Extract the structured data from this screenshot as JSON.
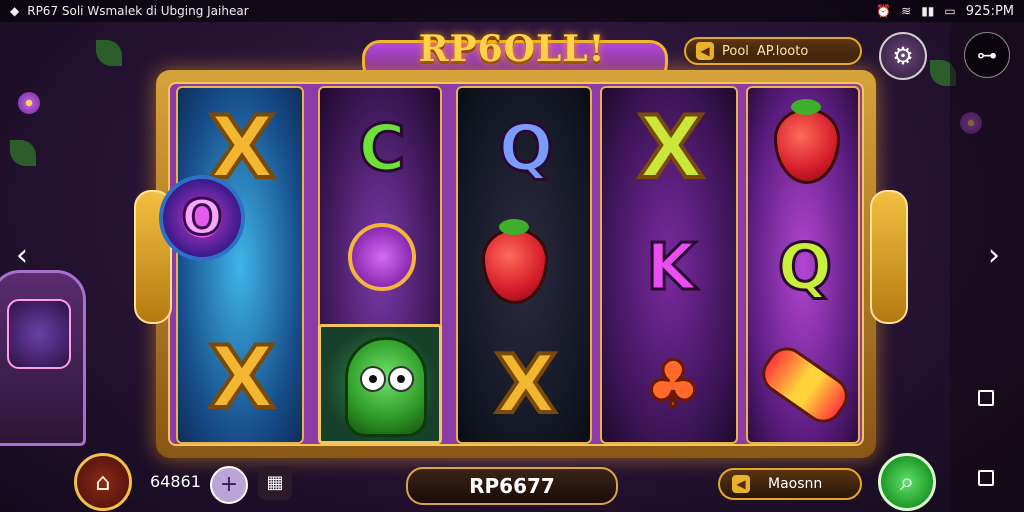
{
  "status_bar": {
    "left_text": "RP67 Soli Wsmalek di Ubging Jaihear",
    "time": "925:PM"
  },
  "game": {
    "title": "RP6OLL!",
    "top_pill": {
      "label_1": "Pool",
      "label_2": "AP.looto"
    },
    "center_display": "RP6677",
    "balance": "64861",
    "right_pill_label": "Maosnn"
  },
  "reels": [
    {
      "symbols": [
        "X",
        "O",
        "X"
      ]
    },
    {
      "symbols": [
        "C",
        "amulet",
        "owl"
      ]
    },
    {
      "symbols": [
        "Q",
        "strawberry",
        "X"
      ]
    },
    {
      "symbols": [
        "X",
        "K",
        "club"
      ]
    },
    {
      "symbols": [
        "strawberry",
        "Q",
        "tube"
      ]
    }
  ],
  "icons": {
    "settings": "gear-icon",
    "home": "home-icon",
    "spin": "search-icon",
    "plus": "plus-icon",
    "bag": "bag-icon",
    "nav_prev": "chevron-left-icon",
    "nav_next": "chevron-right-icon"
  },
  "colors": {
    "gold": "#f3c55a",
    "purple": "#8b3aa6",
    "green": "#1f9a2a"
  }
}
